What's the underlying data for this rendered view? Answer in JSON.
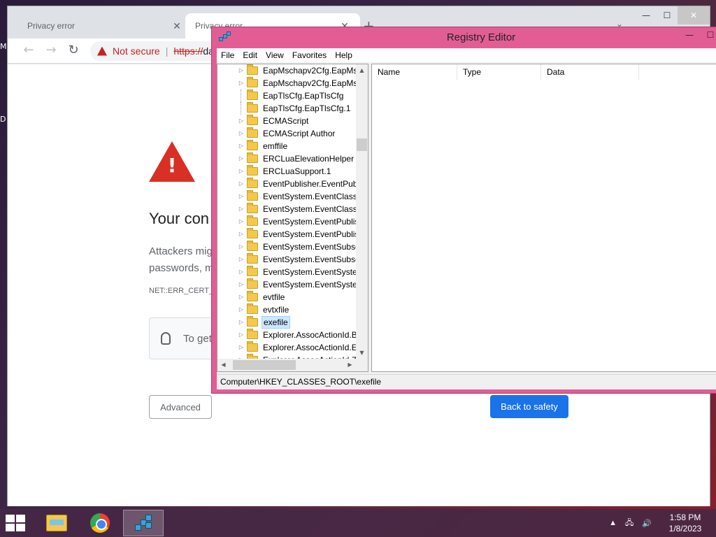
{
  "desktop": {
    "fragment_1": "M",
    "fragment_2": "D"
  },
  "chrome": {
    "tabs": [
      {
        "title": "Privacy error",
        "close": "✕",
        "active": false
      },
      {
        "title": "Privacy error",
        "close": "✕",
        "active": true
      }
    ],
    "new_tab": "+",
    "tab_menu": "⌄",
    "caption": {
      "minimize": "—",
      "maximize": "☐",
      "close": "✕"
    },
    "nav": {
      "back": "←",
      "forward": "→",
      "reload": "↻"
    },
    "omnibox": {
      "security_label": "Not secure",
      "separator": "|",
      "url_scheme": "https://",
      "url_host": "da"
    },
    "page": {
      "error_icon_mark": "!",
      "title": "Your con",
      "text_line_1": "Attackers mig",
      "text_line_2": "passwords, m",
      "error_code": "NET::ERR_CERT_A",
      "tip_text": "To get",
      "advanced_label": "Advanced",
      "back_to_safety_label": "Back to safety"
    }
  },
  "regedit": {
    "title": "Registry Editor",
    "caption": {
      "minimize": "—",
      "maximize": "☐"
    },
    "menu": [
      "File",
      "Edit",
      "View",
      "Favorites",
      "Help"
    ],
    "tree": [
      {
        "label": "EapMschapv2Cfg.EapMsc",
        "expander": "▷"
      },
      {
        "label": "EapMschapv2Cfg.EapMsc",
        "expander": "▷"
      },
      {
        "label": "EapTlsCfg.EapTlsCfg",
        "expander": ""
      },
      {
        "label": "EapTlsCfg.EapTlsCfg.1",
        "expander": ""
      },
      {
        "label": "ECMAScript",
        "expander": "▷"
      },
      {
        "label": "ECMAScript Author",
        "expander": "▷"
      },
      {
        "label": "emffile",
        "expander": "▷"
      },
      {
        "label": "ERCLuaElevationHelper",
        "expander": "▷"
      },
      {
        "label": "ERCLuaSupport.1",
        "expander": "▷"
      },
      {
        "label": "EventPublisher.EventPubl",
        "expander": "▷"
      },
      {
        "label": "EventSystem.EventClass",
        "expander": "▷"
      },
      {
        "label": "EventSystem.EventClass.1",
        "expander": "▷"
      },
      {
        "label": "EventSystem.EventPublish",
        "expander": "▷"
      },
      {
        "label": "EventSystem.EventPublish",
        "expander": "▷"
      },
      {
        "label": "EventSystem.EventSubscr",
        "expander": "▷"
      },
      {
        "label": "EventSystem.EventSubscr",
        "expander": "▷"
      },
      {
        "label": "EventSystem.EventSystem",
        "expander": "▷"
      },
      {
        "label": "EventSystem.EventSystem",
        "expander": "▷"
      },
      {
        "label": "evtfile",
        "expander": "▷"
      },
      {
        "label": "evtxfile",
        "expander": "▷"
      },
      {
        "label": "exefile",
        "expander": "▷",
        "selected": true
      },
      {
        "label": "Explorer.AssocActionId.Bu",
        "expander": "▷"
      },
      {
        "label": "Explorer.AssocActionId.Er",
        "expander": "▷"
      },
      {
        "label": "Explorer.AssocActionId.Zi",
        "expander": "▷"
      }
    ],
    "scroll": {
      "up": "▲",
      "down": "▼",
      "left": "◀",
      "right": "▶"
    },
    "columns": [
      "Name",
      "Type",
      "Data"
    ],
    "status_path": "Computer\\HKEY_CLASSES_ROOT\\exefile"
  },
  "taskbar": {
    "apps": [
      {
        "name": "File Explorer",
        "icon": "folder-icon",
        "active": false
      },
      {
        "name": "Google Chrome",
        "icon": "chrome-icon",
        "active": false
      },
      {
        "name": "Registry Editor",
        "icon": "regedit-icon",
        "active": true
      }
    ],
    "tray": {
      "chevron": "▲",
      "network": "🖧",
      "volume": "🔊"
    },
    "time": "1:58 PM",
    "date": "1/8/2023"
  }
}
